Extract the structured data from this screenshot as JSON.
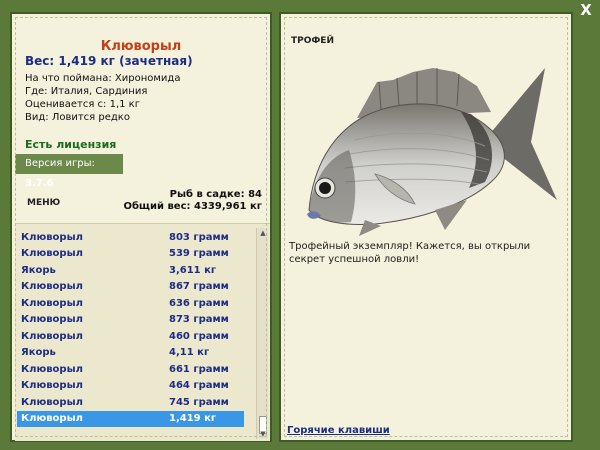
{
  "window": {
    "close": "X"
  },
  "fish": {
    "name": "Клюворыл",
    "weight_line": "Вес: 1,419 кг (зачетная)",
    "bait": "На что поймана: Хирономида",
    "location": "Где: Италия, Сардиния",
    "value": "Оценивается с: 1,1 кг",
    "kind": "Вид: Ловится редко"
  },
  "license": "Есть лицензия",
  "version": {
    "label": "Версия игры:",
    "value": "3.7.6"
  },
  "menu": "МЕНЮ",
  "stats": {
    "fish_count": "Рыб в садке: 84",
    "total_weight": "Общий вес: 4339,961 кг"
  },
  "catch_list": [
    {
      "name": "Клюворыл",
      "weight": "803 грамм"
    },
    {
      "name": "Клюворыл",
      "weight": "539 грамм"
    },
    {
      "name": "Якорь",
      "weight": "3,611 кг"
    },
    {
      "name": "Клюворыл",
      "weight": "867 грамм"
    },
    {
      "name": "Клюворыл",
      "weight": "636 грамм"
    },
    {
      "name": "Клюворыл",
      "weight": "873 грамм"
    },
    {
      "name": "Клюворыл",
      "weight": "460 грамм"
    },
    {
      "name": "Якорь",
      "weight": "4,11 кг"
    },
    {
      "name": "Клюворыл",
      "weight": "661 грамм"
    },
    {
      "name": "Клюворыл",
      "weight": "464 грамм"
    },
    {
      "name": "Клюворыл",
      "weight": "745 грамм"
    },
    {
      "name": "Клюворыл",
      "weight": "1,419 кг"
    }
  ],
  "selected_index": 11,
  "trophy": {
    "label": "ТРОФЕЙ",
    "description": "Трофейный экземпляр! Кажется, вы открыли секрет успешной ловли!"
  },
  "hotkeys": "Горячие клавиши",
  "colors": {
    "background": "#5b7a3a",
    "panel": "#f4f1dc",
    "selection": "#3a97e6",
    "title": "#c2411a",
    "text_blue": "#1e2d84"
  }
}
